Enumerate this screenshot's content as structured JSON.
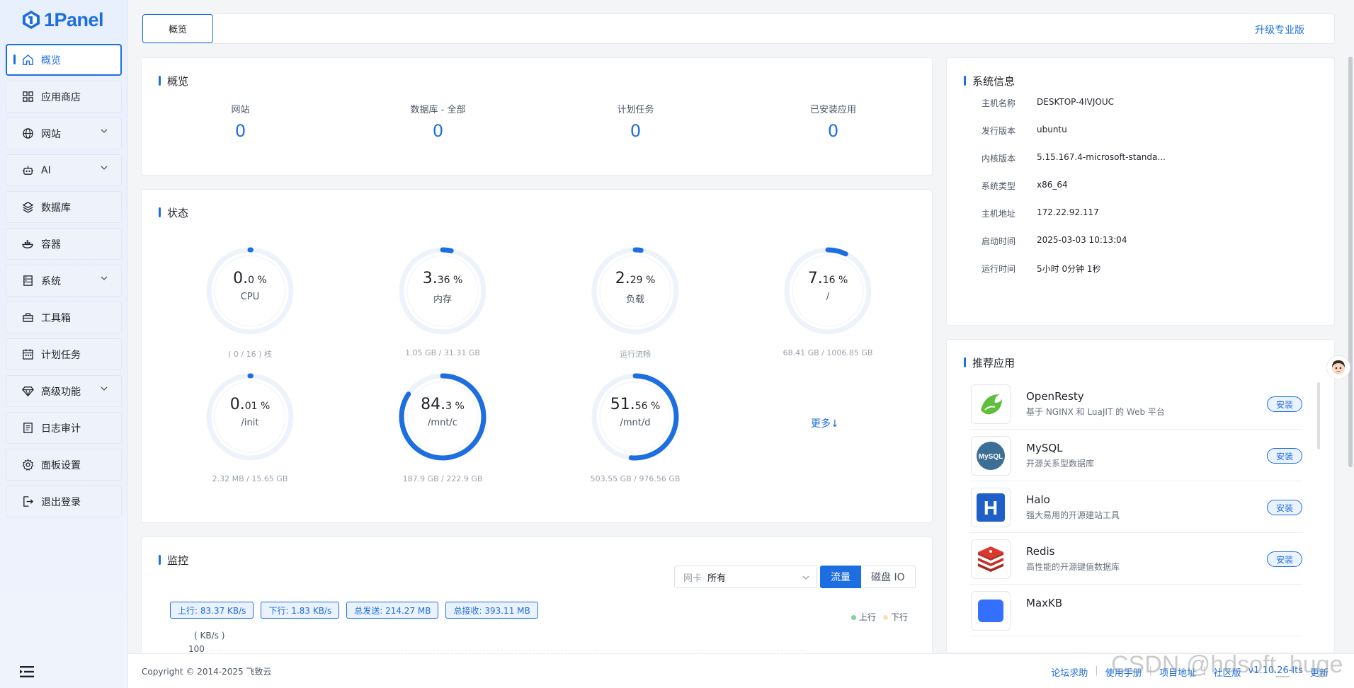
{
  "brand": {
    "logo_text": "1Panel",
    "accent": "#1d6ee0"
  },
  "sidebar": {
    "items": [
      {
        "label": "概览",
        "icon": "home-icon",
        "active": true,
        "expandable": false
      },
      {
        "label": "应用商店",
        "icon": "grid-icon",
        "active": false,
        "expandable": false
      },
      {
        "label": "网站",
        "icon": "globe-icon",
        "active": false,
        "expandable": true
      },
      {
        "label": "AI",
        "icon": "robot-icon",
        "active": false,
        "expandable": true
      },
      {
        "label": "数据库",
        "icon": "layers-icon",
        "active": false,
        "expandable": false
      },
      {
        "label": "容器",
        "icon": "docker-icon",
        "active": false,
        "expandable": false
      },
      {
        "label": "系统",
        "icon": "server-icon",
        "active": false,
        "expandable": true
      },
      {
        "label": "工具箱",
        "icon": "toolbox-icon",
        "active": false,
        "expandable": false
      },
      {
        "label": "计划任务",
        "icon": "calendar-icon",
        "active": false,
        "expandable": false
      },
      {
        "label": "高级功能",
        "icon": "diamond-icon",
        "active": false,
        "expandable": true
      },
      {
        "label": "日志审计",
        "icon": "log-icon",
        "active": false,
        "expandable": false
      },
      {
        "label": "面板设置",
        "icon": "gear-icon",
        "active": false,
        "expandable": false
      },
      {
        "label": "退出登录",
        "icon": "logout-icon",
        "active": false,
        "expandable": false
      }
    ]
  },
  "topbar": {
    "tab": "概览",
    "upgrade": "升级专业版"
  },
  "overview": {
    "title": "概览",
    "stats": [
      {
        "label": "网站",
        "value": "0"
      },
      {
        "label": "数据库 - 全部",
        "value": "0"
      },
      {
        "label": "计划任务",
        "value": "0"
      },
      {
        "label": "已安装应用",
        "value": "0"
      }
    ]
  },
  "status": {
    "title": "状态",
    "gauges": [
      {
        "int": "0.",
        "dec": "0 %",
        "name": "CPU",
        "sub": "( 0 / 16 ) 核",
        "percent": 0.0
      },
      {
        "int": "3.",
        "dec": "36 %",
        "name": "内存",
        "sub": "1.05 GB / 31.31 GB",
        "percent": 3.36
      },
      {
        "int": "2.",
        "dec": "29 %",
        "name": "负载",
        "sub": "运行流畅",
        "percent": 2.29
      },
      {
        "int": "7.",
        "dec": "16 %",
        "name": "/",
        "sub": "68.41 GB / 1006.85 GB",
        "percent": 7.16
      },
      {
        "int": "0.",
        "dec": "01 %",
        "name": "/init",
        "sub": "2.32 MB / 15.65 GB",
        "percent": 0.01
      },
      {
        "int": "84.",
        "dec": "3 %",
        "name": "/mnt/c",
        "sub": "187.9 GB / 222.9 GB",
        "percent": 84.3
      },
      {
        "int": "51.",
        "dec": "56 %",
        "name": "/mnt/d",
        "sub": "503.55 GB / 976.56 GB",
        "percent": 51.56
      }
    ],
    "more": "更多↓"
  },
  "monitor": {
    "title": "监控",
    "nic_placeholder": "网卡",
    "nic_value": "所有",
    "seg_traffic": "流量",
    "seg_disk": "磁盘 IO",
    "tags": [
      "上行: 83.37 KB/s",
      "下行: 1.83 KB/s",
      "总发送: 214.27 MB",
      "总接收: 393.11 MB"
    ],
    "legend_up": "上行",
    "legend_down": "下行",
    "unit": "( KB/s )",
    "y_top": "100",
    "colors": {
      "up": "#7fd49b",
      "down": "#f6e3b4"
    }
  },
  "sysinfo": {
    "title": "系统信息",
    "rows": [
      {
        "k": "主机名称",
        "v": "DESKTOP-4IVJOUC"
      },
      {
        "k": "发行版本",
        "v": "ubuntu"
      },
      {
        "k": "内核版本",
        "v": "5.15.167.4-microsoft-standa..."
      },
      {
        "k": "系统类型",
        "v": "x86_64"
      },
      {
        "k": "主机地址",
        "v": "172.22.92.117"
      },
      {
        "k": "启动时间",
        "v": "2025-03-03 10:13:04"
      },
      {
        "k": "运行时间",
        "v": "5小时 0分钟 1秒"
      }
    ]
  },
  "recommend": {
    "title": "推荐应用",
    "install_label": "安装",
    "apps": [
      {
        "name": "OpenResty",
        "desc": "基于 NGINX 和 LuaJIT 的 Web 平台",
        "icon": "openresty-icon"
      },
      {
        "name": "MySQL",
        "desc": "开源关系型数据库",
        "icon": "mysql-icon"
      },
      {
        "name": "Halo",
        "desc": "强大易用的开源建站工具",
        "icon": "halo-icon"
      },
      {
        "name": "Redis",
        "desc": "高性能的开源键值数据库",
        "icon": "redis-icon"
      },
      {
        "name": "MaxKB",
        "desc": "",
        "icon": "maxkb-icon"
      }
    ]
  },
  "footer": {
    "copyright": "Copyright © 2014-2025 飞致云",
    "links": [
      "论坛求助",
      "使用手册",
      "项目地址",
      "社区版",
      "v1.10.26-lts",
      "更新"
    ]
  },
  "watermark": "CSDN @hdsoft_huge"
}
